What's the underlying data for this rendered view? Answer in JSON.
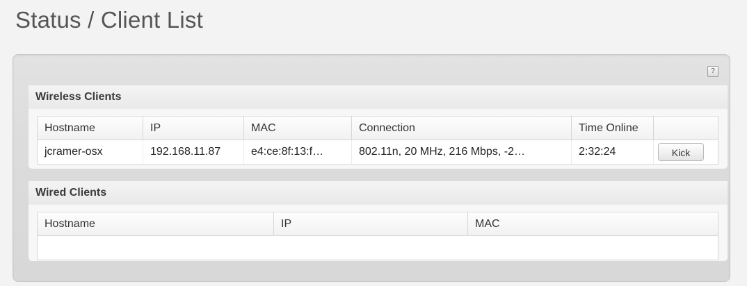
{
  "page": {
    "title": "Status / Client List"
  },
  "help": {
    "label": "?"
  },
  "wireless": {
    "title": "Wireless Clients",
    "columns": [
      "Hostname",
      "IP",
      "MAC",
      "Connection",
      "Time Online",
      ""
    ],
    "rows": [
      {
        "hostname": "jcramer-osx",
        "ip": "192.168.11.87",
        "mac": "e4:ce:8f:13:f…",
        "connection": "802.11n, 20 MHz, 216 Mbps, -2…",
        "time_online": "2:32:24",
        "action_label": "Kick"
      }
    ]
  },
  "wired": {
    "title": "Wired Clients",
    "columns": [
      "Hostname",
      "IP",
      "MAC"
    ],
    "rows": []
  }
}
